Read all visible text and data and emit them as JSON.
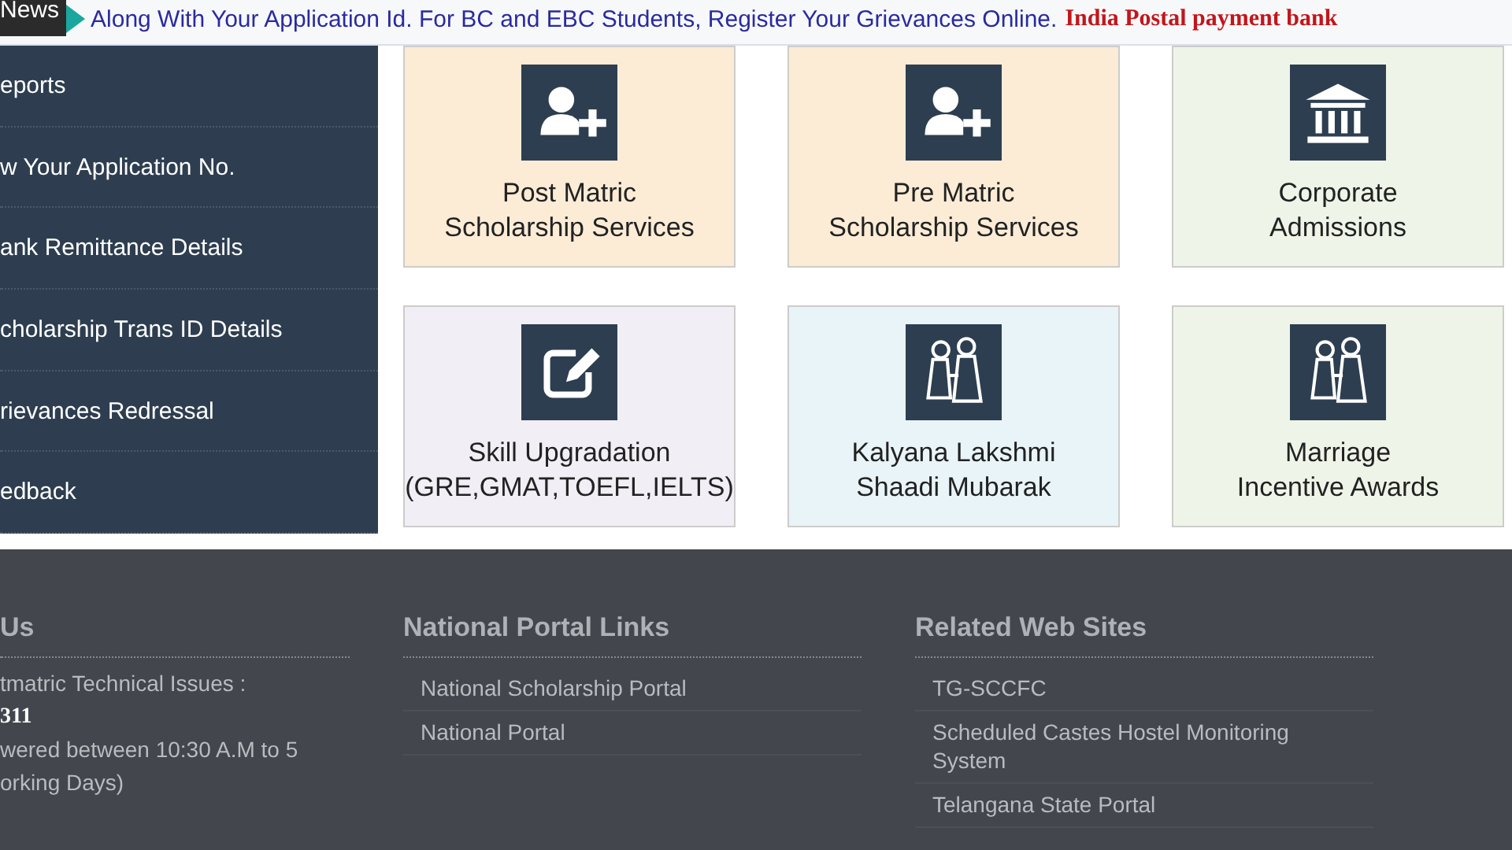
{
  "news": {
    "label": "News",
    "text": "Along With Your Application Id. For BC and EBC Students, Register Your Grievances Online.",
    "highlight": "India Postal payment bank"
  },
  "sidebar": {
    "items": [
      {
        "label": "eports"
      },
      {
        "label": "w Your Application No."
      },
      {
        "label": "ank Remittance Details"
      },
      {
        "label": "cholarship Trans ID Details"
      },
      {
        "label": "rievances Redressal"
      },
      {
        "label": "edback"
      }
    ]
  },
  "tiles": [
    {
      "kind": "person-add",
      "line1": "Post Matric",
      "line2": "Scholarship Services",
      "color": "#fcecd6"
    },
    {
      "kind": "person-add",
      "line1": "Pre Matric",
      "line2": "Scholarship Services",
      "color": "#fcecd6"
    },
    {
      "kind": "institution",
      "line1": "Corporate",
      "line2": "Admissions",
      "color": "#eef5e8"
    },
    {
      "kind": "edit",
      "line1": "Skill Upgradation",
      "line2": "(GRE,GMAT,TOEFL,IELTS)",
      "color": "#f1eff5"
    },
    {
      "kind": "couple",
      "line1": "Kalyana Lakshmi",
      "line2": "Shaadi Mubarak",
      "color": "#e9f4f8"
    },
    {
      "kind": "couple",
      "line1": "Marriage",
      "line2": "Incentive Awards",
      "color": "#eef5e8"
    }
  ],
  "footer": {
    "contact": {
      "heading": "Us",
      "lines": [
        "tmatric Technical Issues :",
        "311",
        "wered between 10:30 A.M to 5",
        "orking Days)"
      ]
    },
    "national_links": {
      "heading": "National Portal Links",
      "links": [
        "National Scholarship Portal",
        "National Portal"
      ]
    },
    "related_sites": {
      "heading": "Related Web Sites",
      "links": [
        "TG-SCCFC",
        "Scheduled Castes Hostel Monitoring System",
        "Telangana State Portal"
      ]
    }
  }
}
